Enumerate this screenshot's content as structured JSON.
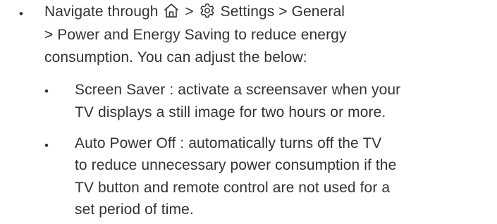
{
  "bullets": {
    "main": "•",
    "sub1": "•",
    "sub2": "•"
  },
  "main": {
    "line1_pre": "Navigate through",
    "line1_sep1": ">",
    "line1_post": "Settings > General",
    "line2": "> Power and Energy Saving to reduce energy",
    "line3": "consumption. You can adjust the below:"
  },
  "sub_items": [
    {
      "lines": [
        "Screen Saver : activate a screensaver when your",
        "TV displays a still image for two hours or more."
      ]
    },
    {
      "lines": [
        "Auto Power Off : automatically turns off the TV",
        "to reduce unnecessary power consumption if the",
        "TV button and remote control are not used for a",
        "set period of time."
      ]
    }
  ],
  "icons": {
    "home": "home-icon",
    "settings": "gear-icon"
  },
  "colors": {
    "text": "#333333"
  }
}
